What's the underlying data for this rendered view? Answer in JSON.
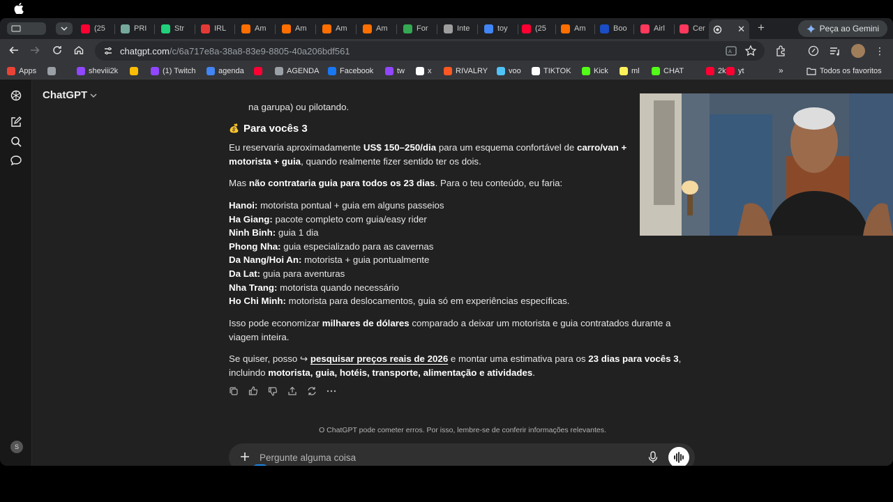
{
  "browser": {
    "tabs": [
      {
        "label": "(25",
        "color": "#ff0033"
      },
      {
        "label": "PRI",
        "color": "#74aa9c"
      },
      {
        "label": "Str",
        "color": "#21d07a"
      },
      {
        "label": "IRL",
        "color": "#e53935"
      },
      {
        "label": "Am",
        "color": "#ff6f00"
      },
      {
        "label": "Am",
        "color": "#ff6f00"
      },
      {
        "label": "Am",
        "color": "#ff6f00"
      },
      {
        "label": "Am",
        "color": "#ff6f00"
      },
      {
        "label": "For",
        "color": "#34a853"
      },
      {
        "label": "Inte",
        "color": "#9e9e9e"
      },
      {
        "label": "toy",
        "color": "#4285f4"
      },
      {
        "label": "(25",
        "color": "#ff0033"
      },
      {
        "label": "Am",
        "color": "#ff6f00"
      },
      {
        "label": "Boo",
        "color": "#1a4dc6"
      },
      {
        "label": "Airl",
        "color": "#ff385c"
      },
      {
        "label": "Cer",
        "color": "#ff385c"
      }
    ],
    "gemini_label": "Peça ao Gemini",
    "url_host": "chatgpt.com",
    "url_path": "/c/6a717e8a-38a8-83e9-8805-40a206bdf561",
    "bookmarks": [
      {
        "label": "Apps",
        "color": "#ea4335"
      },
      {
        "label": "",
        "color": "#9aa0a6"
      },
      {
        "label": "sheviii2k",
        "color": "#9146ff"
      },
      {
        "label": "",
        "color": "#fbbc04"
      },
      {
        "label": "(1) Twitch",
        "color": "#9146ff"
      },
      {
        "label": "agenda",
        "color": "#4285f4"
      },
      {
        "label": "",
        "color": "#ff0033"
      },
      {
        "label": "AGENDA",
        "color": "#9aa0a6"
      },
      {
        "label": "Facebook",
        "color": "#1877f2"
      },
      {
        "label": "tw",
        "color": "#9146ff"
      },
      {
        "label": "x",
        "color": "#ffffff"
      },
      {
        "label": "RIVALRY",
        "color": "#ff5722"
      },
      {
        "label": "voo",
        "color": "#4fc3f7"
      },
      {
        "label": "TIKTOK",
        "color": "#ffffff"
      },
      {
        "label": "Kick",
        "color": "#53fc18"
      },
      {
        "label": "ml",
        "color": "#fff159"
      },
      {
        "label": "CHAT",
        "color": "#53fc18"
      },
      {
        "label": "2k",
        "color": "#ff0033"
      },
      {
        "label": "yt",
        "color": "#ff0033"
      }
    ],
    "all_bookmarks": "Todos os favoritos"
  },
  "app": {
    "brand": "ChatGPT",
    "user_initial": "S"
  },
  "message": {
    "prev_line": "na garupa) ou pilotando.",
    "heading_emoji": "💰",
    "heading": "Para vocês 3",
    "p1_a": "Eu reservaria aproximadamente ",
    "p1_b": "US$ 150–250/dia",
    "p1_c": " para um esquema confortável de ",
    "p1_d": "carro/van +",
    "p1_e": "motorista + guia",
    "p1_f": ", quando realmente fizer sentido ter os dois.",
    "p2_a": "Mas ",
    "p2_b": "não contrataria guia para todos os 23 dias",
    "p2_c": ". Para o teu conteúdo, eu faria:",
    "list": [
      {
        "place": "Hanoi:",
        "plan": " motorista pontual + guia em alguns passeios"
      },
      {
        "place": "Ha Giang:",
        "plan": " pacote completo com guia/easy rider"
      },
      {
        "place": "Ninh Binh:",
        "plan": " guia 1 dia"
      },
      {
        "place": "Phong Nha:",
        "plan": " guia especializado para as cavernas"
      },
      {
        "place": "Da Nang/Hoi An:",
        "plan": " motorista + guia pontualmente"
      },
      {
        "place": "Da Lat:",
        "plan": " guia para aventuras"
      },
      {
        "place": "Nha Trang:",
        "plan": " motorista quando necessário"
      },
      {
        "place": "Ho Chi Minh:",
        "plan": " motorista para deslocamentos, guia só em experiências específicas."
      }
    ],
    "p3_a": "Isso pode economizar ",
    "p3_b": "milhares de dólares",
    "p3_c": " comparado a deixar um motorista e guia contratados durante a viagem inteira.",
    "p4_a": "Se quiser, posso ",
    "p4_arrow": "↪",
    "p4_link": "pesquisar preços reais de 2026",
    "p4_b": " e montar uma estimativa para os ",
    "p4_c": "23 dias para vocês 3",
    "p4_d": ", incluindo ",
    "p4_e": "motorista, guia, hotéis, transporte, alimentação e atividades",
    "p4_f": "."
  },
  "footer": {
    "disclaimer": "O ChatGPT pode cometer erros. Por isso, lembre-se de conferir informações relevantes.",
    "composer_placeholder": "Pergunte alguma coisa"
  }
}
